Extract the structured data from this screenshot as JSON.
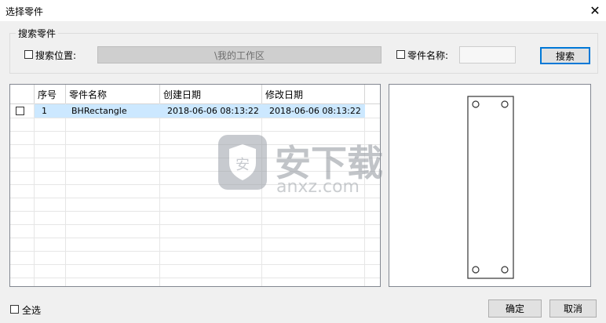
{
  "window": {
    "title": "选择零件"
  },
  "search_group": {
    "label": "搜索零件",
    "location_label": "搜索位置:",
    "location_value": "\\我的工作区",
    "name_label": "零件名称:",
    "name_value": "",
    "search_button": "搜索"
  },
  "table": {
    "columns": [
      "序号",
      "零件名称",
      "创建日期",
      "修改日期"
    ],
    "rows": [
      {
        "index": "1",
        "name": "BHRectangle",
        "created": "2018-06-06 08:13:22",
        "modified": "2018-06-06 08:13:22"
      }
    ]
  },
  "watermark": {
    "text_cn": "安下载",
    "text_en": "anxz.com"
  },
  "footer": {
    "select_all": "全选",
    "ok": "确定",
    "cancel": "取消"
  },
  "colors": {
    "selected_row": "#cce8ff",
    "focus_border": "#0078d7"
  }
}
